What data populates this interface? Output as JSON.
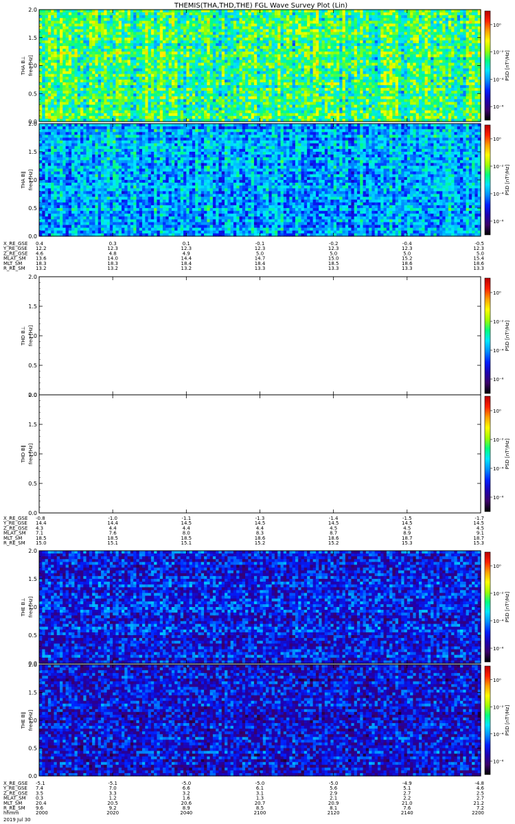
{
  "title": "THEMIS(THA,THD,THE) FGL Wave Survey Plot (Lin)",
  "colorbar": {
    "label": "PSD [nT²/Hz]",
    "ticks": [
      {
        "label": "10⁰",
        "log": 0
      },
      {
        "label": "10⁻²",
        "log": -2
      },
      {
        "label": "10⁻⁴",
        "log": -4
      },
      {
        "label": "10⁻⁶",
        "log": -6
      }
    ],
    "range_log": [
      -7,
      1
    ],
    "colormap": [
      "#000000",
      "#3a0068",
      "#1e00b0",
      "#0020ff",
      "#0090ff",
      "#00e6ff",
      "#00ff80",
      "#a0ff00",
      "#ffff00",
      "#ffa000",
      "#ff2000",
      "#b80000"
    ]
  },
  "panels": [
    {
      "id": "tha-bperp",
      "probe": "THA",
      "component": "B⊥",
      "ylabel": "freq [Hz]",
      "has_data": true,
      "level_log": -2.6,
      "variation": 2.2,
      "stripe_strength": 0.6
    },
    {
      "id": "tha-bpar",
      "probe": "THA",
      "component": "B∥",
      "ylabel": "freq [Hz]",
      "has_data": true,
      "level_log": -3.8,
      "variation": 2.0,
      "stripe_strength": 0.5
    },
    {
      "id": "thd-bperp",
      "probe": "THD",
      "component": "B⊥",
      "ylabel": "freq [Hz]",
      "has_data": false
    },
    {
      "id": "thd-bpar",
      "probe": "THD",
      "component": "B∥",
      "ylabel": "freq [Hz]",
      "has_data": false
    },
    {
      "id": "the-bperp",
      "probe": "THE",
      "component": "B⊥",
      "ylabel": "freq [Hz]",
      "has_data": true,
      "level_log": -5.0,
      "variation": 2.2,
      "stripe_strength": 0.15
    },
    {
      "id": "the-bpar",
      "probe": "THE",
      "component": "B∥",
      "ylabel": "freq [Hz]",
      "has_data": true,
      "level_log": -5.2,
      "variation": 2.2,
      "stripe_strength": 0.15
    }
  ],
  "y_axis": {
    "min": 0.0,
    "max": 2.0,
    "ticks": [
      "0.0",
      "0.5",
      "1.0",
      "1.5",
      "2.0"
    ]
  },
  "time_axis": {
    "start_hhmm": "2000",
    "end_hhmm": "2200",
    "tick_labels": [
      "2000",
      "2020",
      "2040",
      "2100",
      "2120",
      "2140",
      "2200"
    ],
    "date": "2019 Jul 30"
  },
  "ephemeris": [
    {
      "probe": "THA",
      "rows": [
        {
          "label": "X_RE_GSE",
          "values": [
            "0.4",
            "0.3",
            "0.1",
            "-0.1",
            "-0.2",
            "-0.4",
            "-0.5"
          ]
        },
        {
          "label": "Y_RE_GSE",
          "values": [
            "12.2",
            "12.3",
            "12.3",
            "12.3",
            "12.3",
            "12.3",
            "12.3"
          ]
        },
        {
          "label": "Z_RE_GSE",
          "values": [
            "4.6",
            "4.8",
            "4.9",
            "5.0",
            "5.0",
            "5.0",
            "5.0"
          ]
        },
        {
          "label": "MLAT_SM",
          "values": [
            "13.6",
            "14.0",
            "14.4",
            "14.7",
            "15.0",
            "15.2",
            "15.4"
          ]
        },
        {
          "label": "MLT_SM",
          "values": [
            "18.3",
            "18.3",
            "18.4",
            "18.4",
            "18.5",
            "18.6",
            "18.6"
          ]
        },
        {
          "label": "R_RE_SM",
          "values": [
            "13.2",
            "13.2",
            "13.2",
            "13.3",
            "13.3",
            "13.3",
            "13.3"
          ]
        }
      ]
    },
    {
      "probe": "THD",
      "rows": [
        {
          "label": "X_RE_GSE",
          "values": [
            "-0.8",
            "-1.0",
            "-1.1",
            "-1.3",
            "-1.4",
            "-1.5",
            "-1.7"
          ]
        },
        {
          "label": "Y_RE_GSE",
          "values": [
            "14.4",
            "14.4",
            "14.5",
            "14.5",
            "14.5",
            "14.5",
            "14.5"
          ]
        },
        {
          "label": "Z_RE_GSE",
          "values": [
            "4.3",
            "4.4",
            "4.4",
            "4.4",
            "4.5",
            "4.5",
            "4.5"
          ]
        },
        {
          "label": "MLAT_SM",
          "values": [
            "7.1",
            "7.6",
            "8.0",
            "8.3",
            "8.7",
            "8.9",
            "9.1"
          ]
        },
        {
          "label": "MLT_SM",
          "values": [
            "18.5",
            "18.5",
            "18.5",
            "18.6",
            "18.6",
            "18.7",
            "18.7"
          ]
        },
        {
          "label": "R_RE_SM",
          "values": [
            "15.0",
            "15.1",
            "15.1",
            "15.2",
            "15.2",
            "15.3",
            "15.3"
          ]
        }
      ]
    },
    {
      "probe": "THE",
      "rows": [
        {
          "label": "X_RE_GSE",
          "values": [
            "-5.1",
            "-5.1",
            "-5.0",
            "-5.0",
            "-5.0",
            "-4.9",
            "-4.8"
          ]
        },
        {
          "label": "Y_RE_GSE",
          "values": [
            "7.4",
            "7.0",
            "6.6",
            "6.1",
            "5.6",
            "5.1",
            "4.6"
          ]
        },
        {
          "label": "Z_RE_GSE",
          "values": [
            "3.5",
            "3.3",
            "3.2",
            "3.1",
            "2.9",
            "2.7",
            "2.5"
          ]
        },
        {
          "label": "MLAT_SM",
          "values": [
            "0.3",
            "1.2",
            "1.6",
            "1.3",
            "2.1",
            "2.2",
            "2.7"
          ]
        },
        {
          "label": "MLT_SM",
          "values": [
            "20.4",
            "20.5",
            "20.6",
            "20.7",
            "20.9",
            "21.0",
            "21.2"
          ]
        },
        {
          "label": "R_RE_SM",
          "values": [
            "9.6",
            "9.2",
            "8.9",
            "8.5",
            "8.1",
            "7.6",
            "7.2"
          ]
        }
      ]
    }
  ],
  "time_row_label": "hhmm",
  "chart_data": {
    "type": "heatmap",
    "title": "THEMIS(THA,THD,THE) FGL Wave Survey Plot (Lin)",
    "x": {
      "label": "hhmm",
      "ticks": [
        "2000",
        "2020",
        "2040",
        "2100",
        "2120",
        "2140",
        "2200"
      ]
    },
    "y": {
      "label": "freq [Hz]",
      "range": [
        0.0,
        2.0
      ],
      "ticks": [
        0.0,
        0.5,
        1.0,
        1.5,
        2.0
      ]
    },
    "z": {
      "label": "PSD [nT²/Hz]",
      "scale": "log",
      "range": [
        1e-07,
        10
      ]
    },
    "grid": false,
    "panel_labels": [
      "THA B⊥",
      "THA B∥",
      "THD B⊥",
      "THD B∥",
      "THE B⊥",
      "THE B∥"
    ],
    "panel_notes": {
      "THD B⊥": "no data",
      "THD B∥": "no data"
    }
  }
}
